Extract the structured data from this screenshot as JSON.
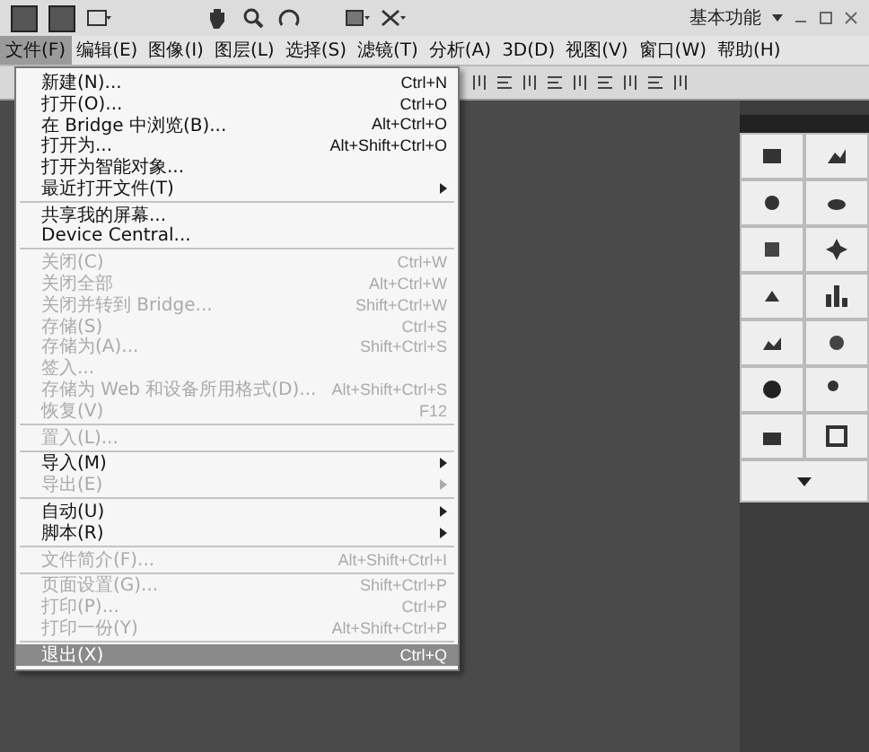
{
  "title_bar": {
    "workspace": "基本功能"
  },
  "menu_bar": [
    {
      "label": "文件(F)",
      "selected": true
    },
    {
      "label": "编辑(E)",
      "selected": false
    },
    {
      "label": "图像(I)",
      "selected": false
    },
    {
      "label": "图层(L)",
      "selected": false
    },
    {
      "label": "选择(S)",
      "selected": false
    },
    {
      "label": "滤镜(T)",
      "selected": false
    },
    {
      "label": "分析(A)",
      "selected": false
    },
    {
      "label": "3D(D)",
      "selected": false
    },
    {
      "label": "视图(V)",
      "selected": false
    },
    {
      "label": "窗口(W)",
      "selected": false
    },
    {
      "label": "帮助(H)",
      "selected": false
    }
  ],
  "file_menu": [
    {
      "kind": "item",
      "label": "新建(N)...",
      "shortcut": "Ctrl+N",
      "disabled": false,
      "selected": false
    },
    {
      "kind": "item",
      "label": "打开(O)...",
      "shortcut": "Ctrl+O",
      "disabled": false,
      "selected": false
    },
    {
      "kind": "item",
      "label": "在 Bridge 中浏览(B)...",
      "shortcut": "Alt+Ctrl+O",
      "disabled": false,
      "selected": false
    },
    {
      "kind": "item",
      "label": "打开为...",
      "shortcut": "Alt+Shift+Ctrl+O",
      "disabled": false,
      "selected": false
    },
    {
      "kind": "item",
      "label": "打开为智能对象...",
      "disabled": false,
      "selected": false
    },
    {
      "kind": "submenu",
      "label": "最近打开文件(T)",
      "disabled": false,
      "selected": false
    },
    {
      "kind": "separator"
    },
    {
      "kind": "item",
      "label": "共享我的屏幕...",
      "disabled": false,
      "selected": false
    },
    {
      "kind": "item",
      "label": "Device Central...",
      "disabled": false,
      "selected": false
    },
    {
      "kind": "separator"
    },
    {
      "kind": "item",
      "label": "关闭(C)",
      "shortcut": "Ctrl+W",
      "disabled": true,
      "selected": false
    },
    {
      "kind": "item",
      "label": "关闭全部",
      "shortcut": "Alt+Ctrl+W",
      "disabled": true,
      "selected": false
    },
    {
      "kind": "item",
      "label": "关闭并转到 Bridge...",
      "shortcut": "Shift+Ctrl+W",
      "disabled": true,
      "selected": false
    },
    {
      "kind": "item",
      "label": "存储(S)",
      "shortcut": "Ctrl+S",
      "disabled": true,
      "selected": false
    },
    {
      "kind": "item",
      "label": "存储为(A)...",
      "shortcut": "Shift+Ctrl+S",
      "disabled": true,
      "selected": false
    },
    {
      "kind": "item",
      "label": "签入...",
      "disabled": true,
      "selected": false
    },
    {
      "kind": "item",
      "label": "存储为 Web 和设备所用格式(D)...",
      "shortcut": "Alt+Shift+Ctrl+S",
      "disabled": true,
      "selected": false
    },
    {
      "kind": "item",
      "label": "恢复(V)",
      "shortcut": "F12",
      "disabled": true,
      "selected": false
    },
    {
      "kind": "separator"
    },
    {
      "kind": "item",
      "label": "置入(L)...",
      "disabled": true,
      "selected": false
    },
    {
      "kind": "separator"
    },
    {
      "kind": "submenu",
      "label": "导入(M)",
      "disabled": false,
      "selected": false
    },
    {
      "kind": "submenu",
      "label": "导出(E)",
      "disabled": true,
      "selected": false
    },
    {
      "kind": "separator"
    },
    {
      "kind": "submenu",
      "label": "自动(U)",
      "disabled": false,
      "selected": false
    },
    {
      "kind": "submenu",
      "label": "脚本(R)",
      "disabled": false,
      "selected": false
    },
    {
      "kind": "separator"
    },
    {
      "kind": "item",
      "label": "文件简介(F)...",
      "shortcut": "Alt+Shift+Ctrl+I",
      "disabled": true,
      "selected": false
    },
    {
      "kind": "separator"
    },
    {
      "kind": "item",
      "label": "页面设置(G)...",
      "shortcut": "Shift+Ctrl+P",
      "disabled": true,
      "selected": false
    },
    {
      "kind": "item",
      "label": "打印(P)...",
      "shortcut": "Ctrl+P",
      "disabled": true,
      "selected": false
    },
    {
      "kind": "item",
      "label": "打印一份(Y)",
      "shortcut": "Alt+Shift+Ctrl+P",
      "disabled": true,
      "selected": false
    },
    {
      "kind": "separator"
    },
    {
      "kind": "item",
      "label": "退出(X)",
      "shortcut": "Ctrl+Q",
      "disabled": false,
      "selected": true
    }
  ]
}
